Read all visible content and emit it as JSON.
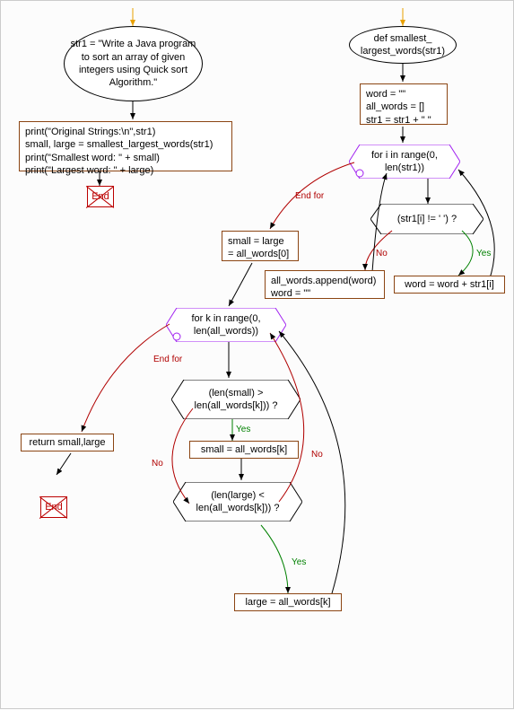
{
  "chart_data": {
    "type": "flowchart",
    "left_branch": {
      "start": {
        "type": "ellipse",
        "text": "str1 = \"Write a Java program to sort an array of given integers using Quick sort Algorithm.\""
      },
      "process": {
        "type": "rect",
        "lines": [
          "print(\"Original Strings:\\n\",str1)",
          "small, large = smallest_largest_words(str1)",
          "print(\"Smallest word: \" + small)",
          "print(\"Largest word: \" + large)"
        ]
      },
      "end": {
        "type": "end",
        "text": "End"
      }
    },
    "right_branch": {
      "func_def": {
        "type": "ellipse",
        "text": "def smallest_\nlargest_words(str1)"
      },
      "init": {
        "type": "rect",
        "lines": [
          "word = \"\"",
          "all_words = []",
          "str1 = str1 + \" \""
        ]
      },
      "loop1": {
        "type": "hexagon",
        "text": "for i in range(0, len(str1))",
        "end_label": "End for"
      },
      "cond1": {
        "type": "diamond",
        "text": "(str1[i] != ' ') ?",
        "yes_label": "Yes",
        "no_label": "No"
      },
      "cond1_yes": {
        "type": "rect",
        "text": "word = word + str1[i]"
      },
      "cond1_no": {
        "type": "rect",
        "lines": [
          "all_words.append(word)",
          "word = \"\""
        ]
      },
      "assign_small_large": {
        "type": "rect",
        "lines": [
          "small = large",
          "= all_words[0]"
        ]
      },
      "loop2": {
        "type": "hexagon",
        "text": "for k in range(0, len(all_words))",
        "end_label": "End for"
      },
      "return": {
        "type": "rect",
        "text": "return small,large"
      },
      "end2": {
        "type": "end",
        "text": "End"
      },
      "cond2": {
        "type": "diamond",
        "text": "(len(small) > len(all_words[k])) ?",
        "yes_label": "Yes",
        "no_label": "No"
      },
      "cond2_yes": {
        "type": "rect",
        "text": "small = all_words[k]"
      },
      "cond3": {
        "type": "diamond",
        "text": "(len(large) < len(all_words[k])) ?",
        "yes_label": "Yes",
        "no_label": "No"
      },
      "cond3_yes": {
        "type": "rect",
        "text": "large = all_words[k]"
      }
    }
  },
  "nodes": {
    "str1_init": "str1 = \"Write a Java program to sort an array of given integers using Quick sort Algorithm.\"",
    "print_block_l1": "print(\"Original Strings:\\n\",str1)",
    "print_block_l2": "small, large = smallest_largest_words(str1)",
    "print_block_l3": "print(\"Smallest word: \" + small)",
    "print_block_l4": "print(\"Largest word: \" + large)",
    "end1": "End",
    "func_def_l1": "def smallest_",
    "func_def_l2": "largest_words(str1)",
    "init_l1": "word = \"\"",
    "init_l2": "all_words = []",
    "init_l3": "str1 = str1 + \" \"",
    "loop1_l1": "for i in range(0,",
    "loop1_l2": "len(str1))",
    "end_for": "End for",
    "cond1": "(str1[i] != ' ') ?",
    "yes": "Yes",
    "no": "No",
    "cond1_yes": "word = word + str1[i]",
    "cond1_no_l1": "all_words.append(word)",
    "cond1_no_l2": "word = \"\"",
    "slarge_l1": "small = large",
    "slarge_l2": "= all_words[0]",
    "loop2_l1": "for k in range(0,",
    "loop2_l2": "len(all_words))",
    "return": "return small,large",
    "end2": "End",
    "cond2_l1": "(len(small) >",
    "cond2_l2": "len(all_words[k])) ?",
    "cond2_yes": "small = all_words[k]",
    "cond3_l1": "(len(large) <",
    "cond3_l2": "len(all_words[k])) ?",
    "cond3_yes": "large = all_words[k]"
  }
}
